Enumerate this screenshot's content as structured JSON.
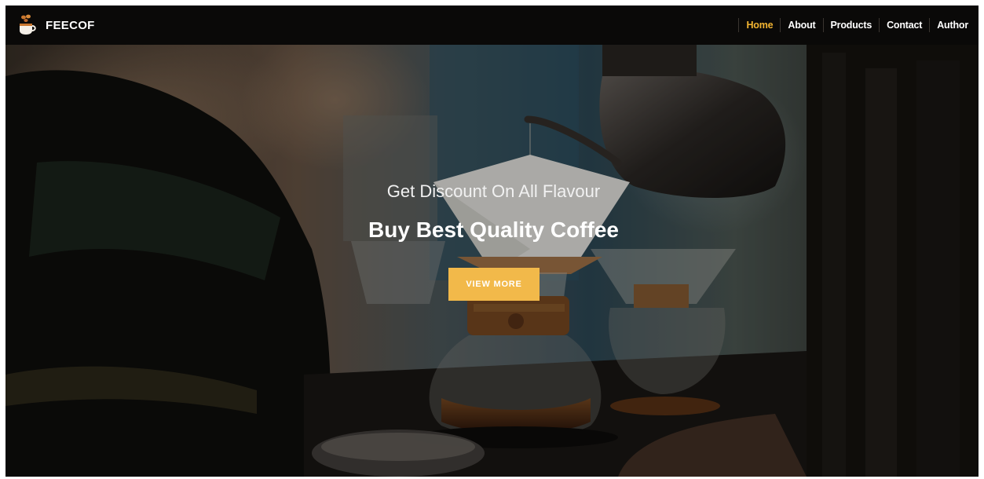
{
  "brand": {
    "name": "FEECOF",
    "icon": "coffee-cup-icon"
  },
  "nav": {
    "items": [
      {
        "label": "Home",
        "active": true
      },
      {
        "label": "About",
        "active": false
      },
      {
        "label": "Products",
        "active": false
      },
      {
        "label": "Contact",
        "active": false
      },
      {
        "label": "Author",
        "active": false
      }
    ]
  },
  "hero": {
    "subtitle": "Get Discount On All Flavour",
    "title": "Buy Best Quality Coffee",
    "button_label": "VIEW MORE"
  },
  "colors": {
    "accent": "#f2b431",
    "button": "#f2b94a",
    "navbar": "#0a0908"
  }
}
